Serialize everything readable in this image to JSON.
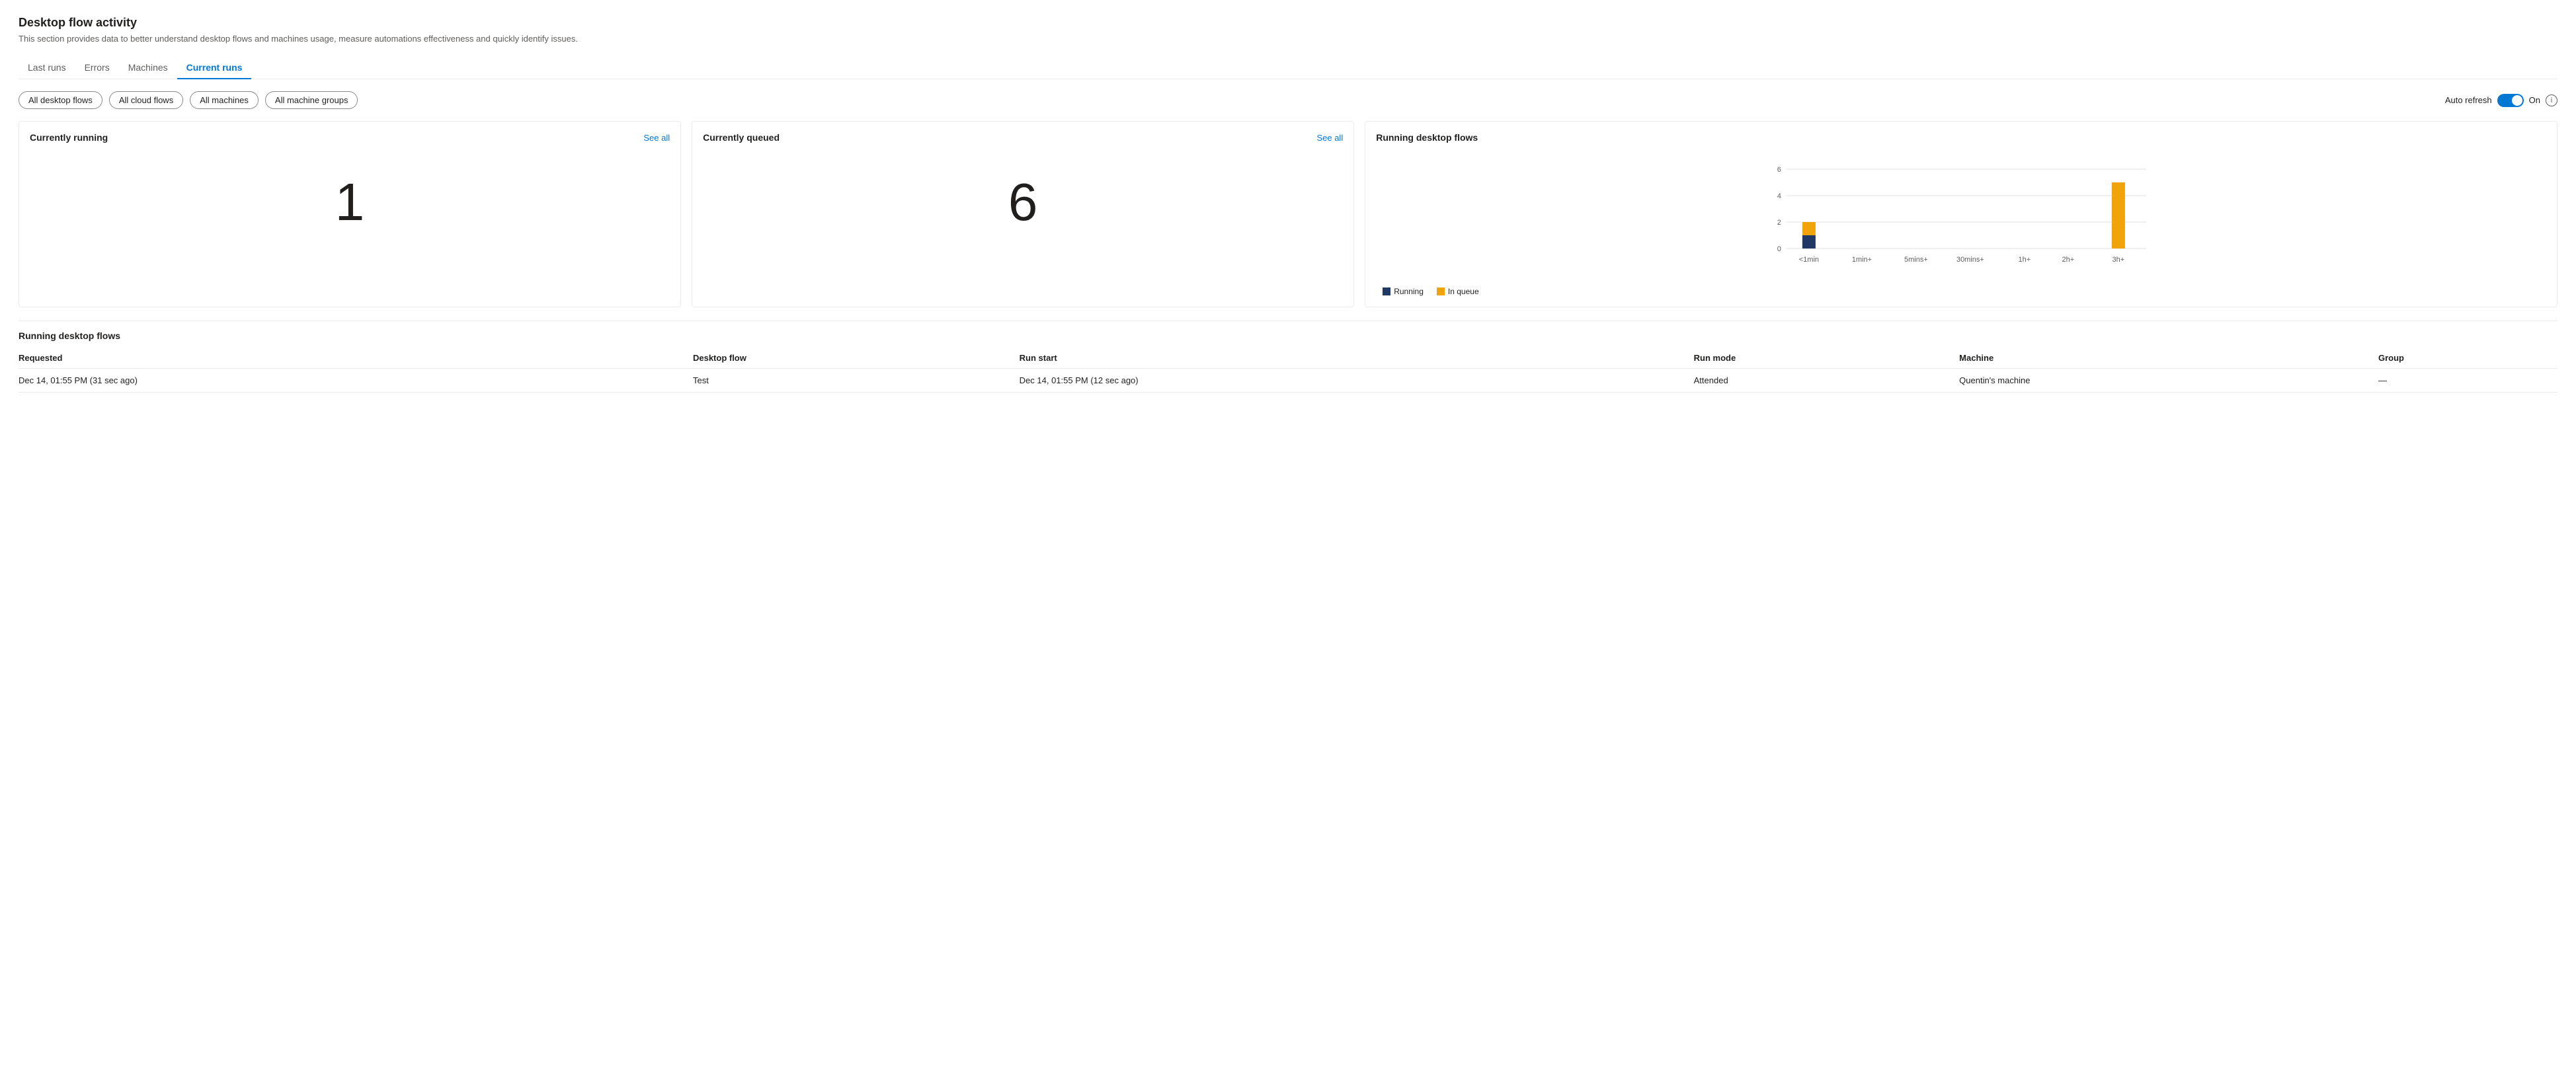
{
  "page": {
    "title": "Desktop flow activity",
    "subtitle": "This section provides data to better understand desktop flows and machines usage, measure automations effectiveness and quickly identify issues."
  },
  "tabs": [
    {
      "id": "last-runs",
      "label": "Last runs",
      "active": false
    },
    {
      "id": "errors",
      "label": "Errors",
      "active": false
    },
    {
      "id": "machines",
      "label": "Machines",
      "active": false
    },
    {
      "id": "current-runs",
      "label": "Current runs",
      "active": true
    }
  ],
  "filters": [
    {
      "id": "all-desktop-flows",
      "label": "All desktop flows"
    },
    {
      "id": "all-cloud-flows",
      "label": "All cloud flows"
    },
    {
      "id": "all-machines",
      "label": "All machines"
    },
    {
      "id": "all-machine-groups",
      "label": "All machine groups"
    }
  ],
  "autoRefresh": {
    "label": "Auto refresh",
    "status": "On"
  },
  "cards": {
    "currentlyRunning": {
      "title": "Currently running",
      "seeAllLabel": "See all",
      "value": "1"
    },
    "currentlyQueued": {
      "title": "Currently queued",
      "seeAllLabel": "See all",
      "value": "6"
    },
    "runningDesktopFlows": {
      "title": "Running desktop flows",
      "chart": {
        "xLabels": [
          "<1min",
          "1min+",
          "5mins+",
          "30mins+",
          "1h+",
          "2h+",
          "3h+"
        ],
        "yLabels": [
          "0",
          "2",
          "4",
          "6"
        ],
        "bars": [
          {
            "label": "<1min",
            "running": 1,
            "inQueue": 1
          },
          {
            "label": "1min+",
            "running": 0,
            "inQueue": 0
          },
          {
            "label": "5mins+",
            "running": 0,
            "inQueue": 0
          },
          {
            "label": "30mins+",
            "running": 0,
            "inQueue": 0
          },
          {
            "label": "1h+",
            "running": 0,
            "inQueue": 0
          },
          {
            "label": "2h+",
            "running": 0,
            "inQueue": 0
          },
          {
            "label": "3h+",
            "running": 0,
            "inQueue": 5
          }
        ],
        "legend": [
          {
            "id": "running",
            "label": "Running",
            "color": "#1f3864"
          },
          {
            "id": "in-queue",
            "label": "In queue",
            "color": "#f0a30a"
          }
        ]
      }
    }
  },
  "tableSection": {
    "title": "Running desktop flows",
    "columns": [
      "Requested",
      "Desktop flow",
      "Run start",
      "Run mode",
      "Machine",
      "Group"
    ],
    "rows": [
      {
        "requested": "Dec 14, 01:55 PM (31 sec ago)",
        "desktopFlow": "Test",
        "runStart": "Dec 14, 01:55 PM (12 sec ago)",
        "runMode": "Attended",
        "machine": "Quentin's machine",
        "group": "—"
      }
    ]
  }
}
